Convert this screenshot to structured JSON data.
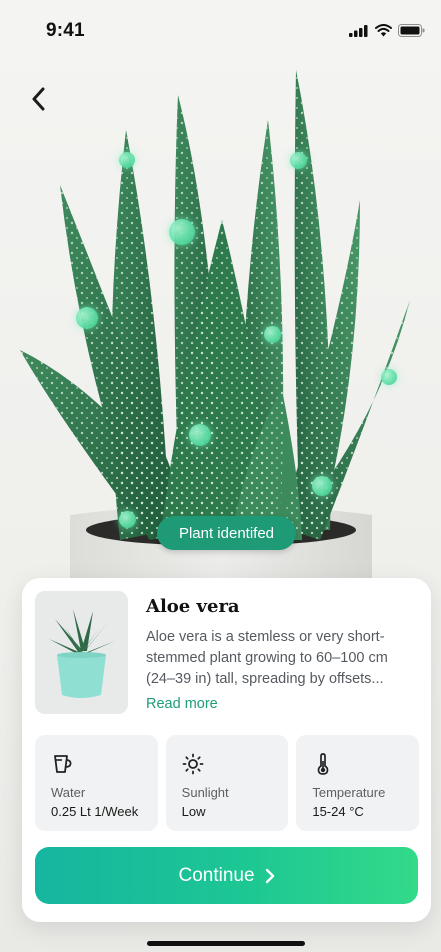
{
  "status_bar": {
    "time": "9:41",
    "icons": [
      "signal-icon",
      "wifi-icon",
      "battery-icon"
    ]
  },
  "navigation": {
    "back_icon": "chevron-left-icon"
  },
  "scan": {
    "badge_label": "Plant identifed",
    "accent_color": "#1f9a76"
  },
  "plant": {
    "name": "Aloe vera",
    "description": "Aloe vera is a stemless or very short-stemmed plant growing to 60–100 cm (24–39 in) tall, spreading by offsets...",
    "read_more_label": "Read more"
  },
  "care": [
    {
      "icon": "water-jug-icon",
      "label": "Water",
      "value": "0.25 Lt 1/Week"
    },
    {
      "icon": "sun-icon",
      "label": "Sunlight",
      "value": "Low"
    },
    {
      "icon": "thermometer-icon",
      "label": "Temperature",
      "value": "15-24 °C"
    }
  ],
  "actions": {
    "continue_label": "Continue",
    "continue_icon": "chevron-right-icon",
    "button_gradient": [
      "#16b5a0",
      "#33da8a"
    ]
  }
}
